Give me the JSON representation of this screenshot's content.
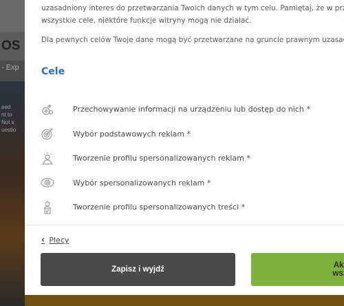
{
  "background": {
    "logo_fragment": "OS",
    "crumb_fragment": "- Exp",
    "hero_lines": [
      "eed",
      "nt to",
      "Not s",
      "uestio"
    ]
  },
  "modal": {
    "intro_line1": "uzasadniony interes do przetwarzania Twoich danych w tym celu. Pamiętaj, że w przypadku",
    "intro_line2": "wszystkie cele, niektóre funkcje witryny mogą nie działać.",
    "legal_basis": "Dla pewnych celów Twoje dane mogą być przetwarzane na gruncie prawnym uzasadnionego interesu",
    "section_title": "Cele",
    "purposes": [
      {
        "label": "Przechowywanie informacji na urządzeniu lub dostęp do nich *",
        "icon": "device-storage-icon"
      },
      {
        "label": "Wybór podstawowych reklam *",
        "icon": "target-icon"
      },
      {
        "label": "Tworzenie profilu spersonalizowanych reklam *",
        "icon": "profile-ads-icon"
      },
      {
        "label": "Wybór spersonalizowanych reklam *",
        "icon": "eye-target-icon"
      },
      {
        "label": "Tworzenie profilu spersonalizowanych treści *",
        "icon": "profile-content-icon"
      }
    ],
    "back_label": "Plecy",
    "save_label": "Zapisz i wyjdź",
    "accept_label": "Akceptuj wszystko"
  },
  "colors": {
    "accent_link": "#2f6ec7",
    "save_button": "#4a4a4a",
    "accept_button": "#7fb13e"
  }
}
